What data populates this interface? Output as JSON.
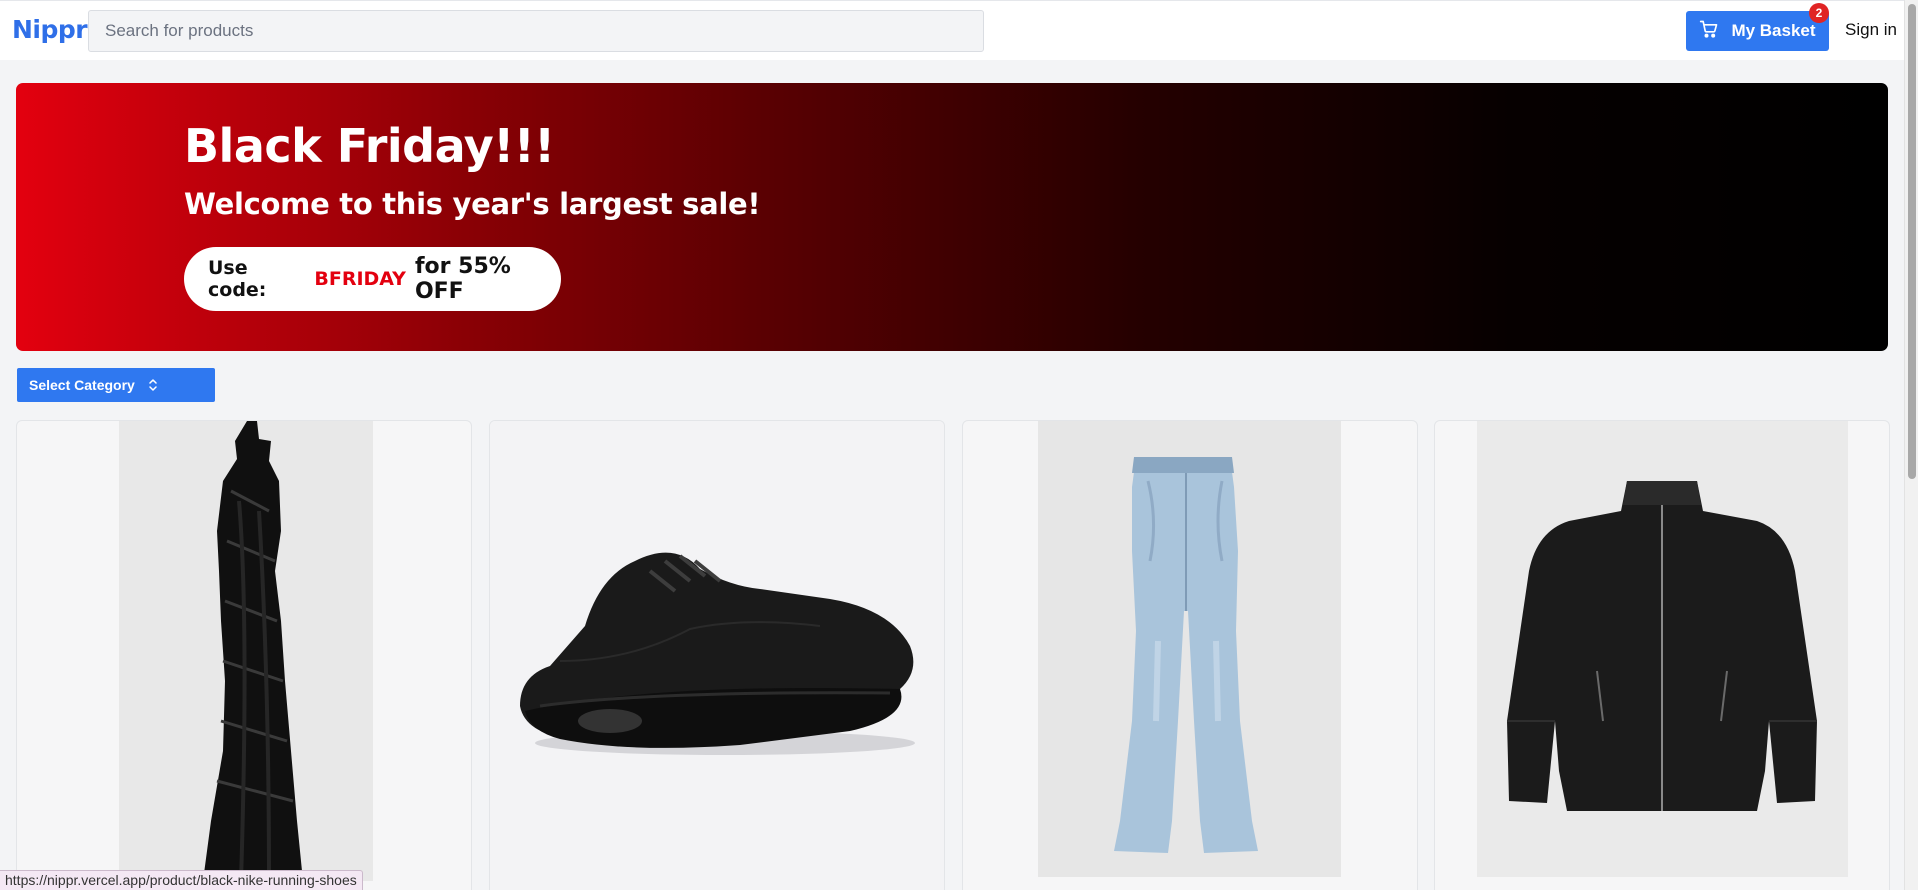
{
  "header": {
    "logo": "Nippr",
    "search_placeholder": "Search for products",
    "basket_label": "My Basket",
    "basket_count": "2",
    "signin_label": "Sign in"
  },
  "banner": {
    "title": "Black Friday!!!",
    "subtitle": "Welcome to this year's largest sale!",
    "promo_prefix": "Use code:",
    "promo_code": "BFRIDAY",
    "promo_suffix": "for 55% OFF"
  },
  "filter": {
    "select_label": "Select Category"
  },
  "products": [
    {
      "name": "black sequin dress"
    },
    {
      "name": "black nike running shoes"
    },
    {
      "name": "light blue flare jeans"
    },
    {
      "name": "black leather jacket"
    }
  ],
  "status_url": "https://nippr.vercel.app/product/black-nike-running-shoes",
  "colors": {
    "accent": "#2f78f0",
    "logo": "#2f6fe8",
    "promo_code": "#e3000f",
    "badge": "#e02424"
  }
}
